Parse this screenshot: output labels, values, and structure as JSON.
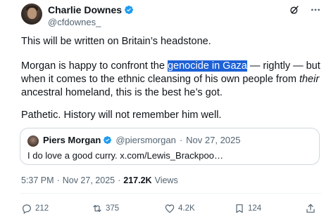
{
  "author": {
    "display_name": "Charlie Downes",
    "handle": "@cfdownes_",
    "verified": true
  },
  "top_actions": {
    "grok_icon": "slashed-circle-icon",
    "more_icon": "more-dots-icon"
  },
  "tweet": {
    "para1": "This will be written on Britain’s headstone.",
    "para2_pre": "Morgan is happy to confront the ",
    "para2_highlight": "genocide in Gaza",
    "para2_mid": " — rightly — but when it comes to the ethnic cleansing of his own people from ",
    "para2_italic": "their",
    "para2_post": " ancestral homeland, this is the best he’s got.",
    "para3": "Pathetic. History will not remember him well."
  },
  "quote": {
    "display_name": "Piers Morgan",
    "handle": "@piersmorgan",
    "separator": "·",
    "date": "Nov 27, 2025",
    "text": "I do love a good curry. x.com/Lewis_Brackpoo…"
  },
  "meta": {
    "time": "5:37 PM",
    "separator": "·",
    "date": "Nov 27, 2025",
    "views_count": "217.2K",
    "views_label": "Views"
  },
  "actions": {
    "replies": "212",
    "reposts": "375",
    "likes": "4.2K",
    "bookmarks": "124"
  },
  "colors": {
    "verified_blue": "#1d9bf0",
    "highlight": "#1d61d6",
    "secondary_text": "#536471"
  }
}
